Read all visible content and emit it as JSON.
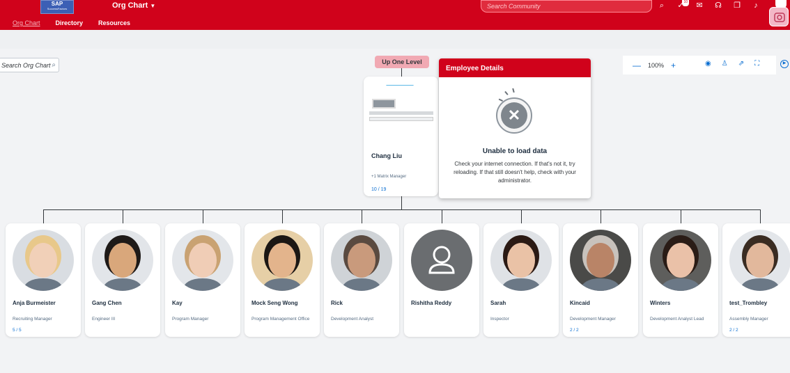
{
  "header": {
    "logo_text": "SAP",
    "logo_sub": "SuccessFactors",
    "app_title": "Org Chart",
    "search_placeholder": "Search Community",
    "nav": [
      "Org Chart",
      "Directory",
      "Resources"
    ],
    "notification_badge": "10"
  },
  "search": {
    "placeholder": "Search Org Chart"
  },
  "toolbar": {
    "zoom": "100%"
  },
  "up_level_label": "Up One Level",
  "manager": {
    "name": "Chang Liu",
    "matrix": "+1 Matrix Manager",
    "count": "10 / 19"
  },
  "details": {
    "title": "Employee Details",
    "error_title": "Unable to load data",
    "error_message": "Check your internet connection. If that's not it, try reloading. If that still doesn't help, check with your administrator."
  },
  "reports": [
    {
      "name": "Anja Burmeister",
      "title": "Recruiting Manager",
      "count": "5 / 5",
      "skin": "#f1d0b8",
      "hair": "#e8c88a",
      "bg": "#d9dde2"
    },
    {
      "name": "Gang Chen",
      "title": "Engineer III",
      "count": "",
      "skin": "#d9a77b",
      "hair": "#1e1a18",
      "bg": "#e2e5e9"
    },
    {
      "name": "Kay",
      "title": "Program Manager",
      "count": "",
      "skin": "#f0cdb6",
      "hair": "#c9a272",
      "bg": "#e3e6ea"
    },
    {
      "name": "Mock Seng Wong",
      "title": "Program Management Office",
      "count": "",
      "skin": "#e3b48c",
      "hair": "#1b1714",
      "bg": "#e6cfa6"
    },
    {
      "name": "Rick",
      "title": "Development Analyst",
      "count": "",
      "skin": "#c99a7c",
      "hair": "#5a4a40",
      "bg": "#cfd3d7"
    },
    {
      "name": "Rishitha Reddy",
      "title": "",
      "count": "",
      "skin": "",
      "hair": "",
      "bg": "#6a6d70"
    },
    {
      "name": "Sarah",
      "title": "Inspector",
      "count": "",
      "skin": "#eac2a6",
      "hair": "#2b1a14",
      "bg": "#dfe2e6"
    },
    {
      "name": "Kincaid",
      "title": "Development Manager",
      "count": "2 / 2",
      "skin": "#b98467",
      "hair": "#c8c2bc",
      "bg": "#4a4a48"
    },
    {
      "name": "Winters",
      "title": "Development Analyst Lead",
      "count": "",
      "skin": "#eac1a8",
      "hair": "#2a1c16",
      "bg": "#5e5e5c"
    },
    {
      "name": "test_Trombley",
      "title": "Assembly Manager",
      "count": "2 / 2",
      "skin": "#e2b89c",
      "hair": "#3a2c22",
      "bg": "#e3e6ea"
    }
  ]
}
